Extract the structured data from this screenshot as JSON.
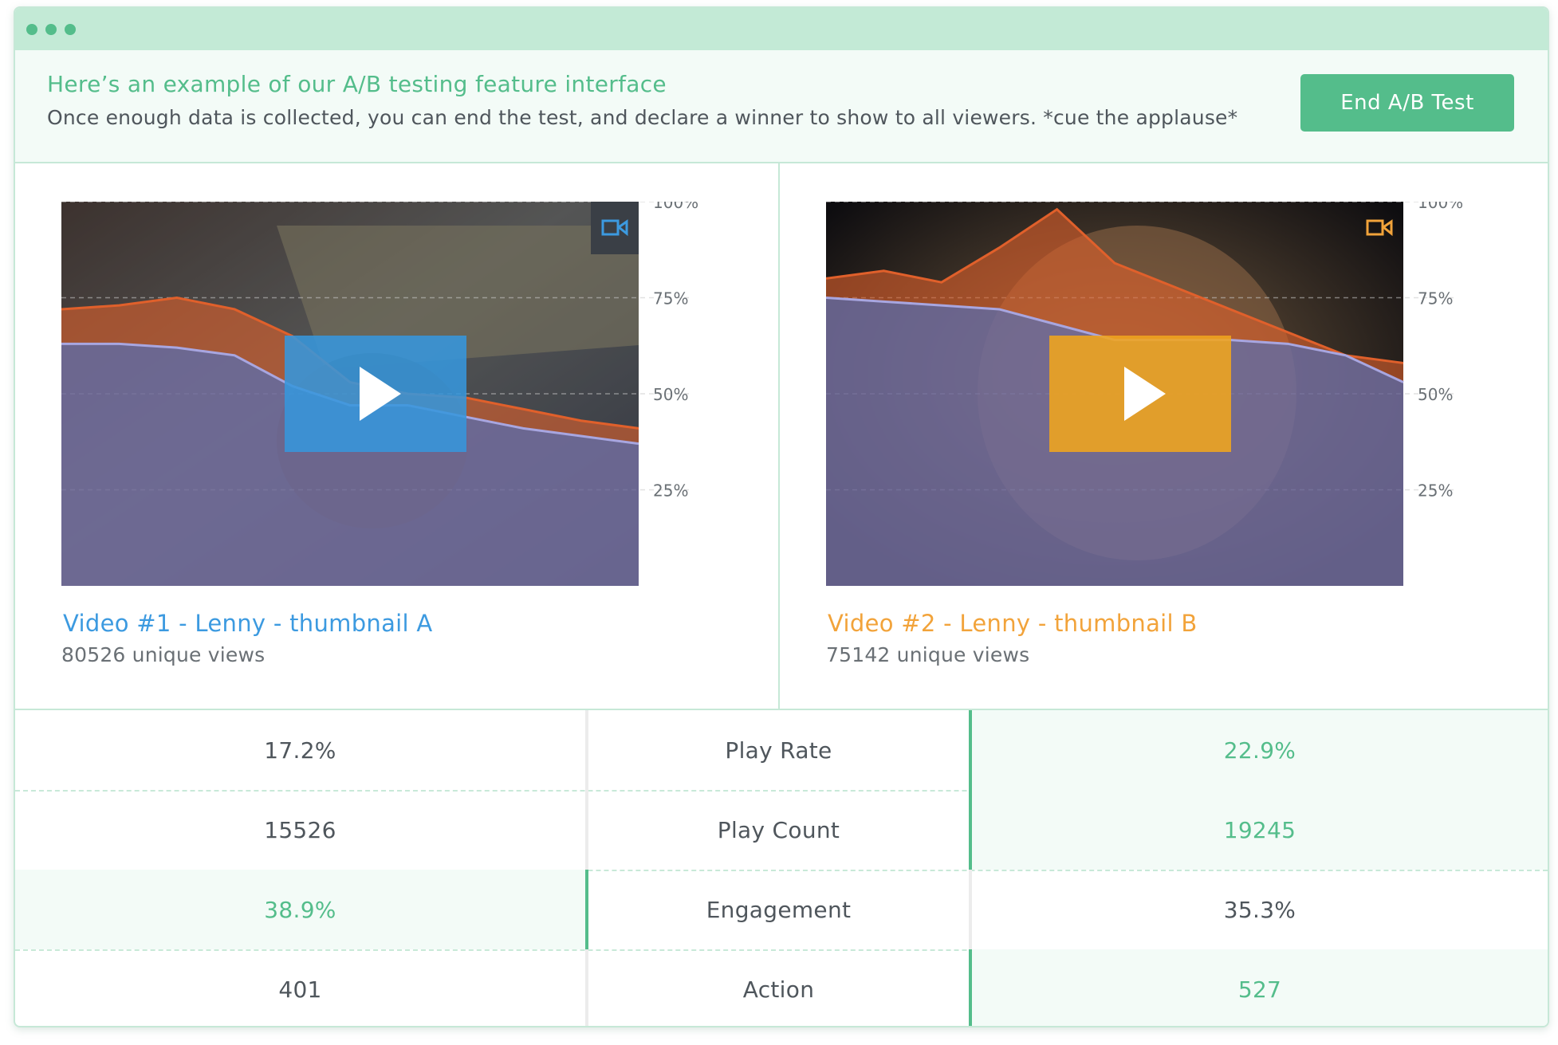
{
  "header": {
    "title": "Here’s an example of our A/B testing feature interface",
    "description": "Once enough data is collected, you can end the test, and declare a winner to show to all viewers. *cue the applause*",
    "end_button": "End A/B Test"
  },
  "videos": [
    {
      "title": "Video #1 - Lenny - thumbnail A",
      "views": "80526 unique views",
      "accent": "#3c9ae0",
      "icon": "video-camera-icon"
    },
    {
      "title": "Video #2 - Lenny - thumbnail B",
      "views": "75142 unique views",
      "accent": "#f2a33a",
      "icon": "video-camera-icon"
    }
  ],
  "chart_data": [
    {
      "type": "area",
      "ylim": [
        0,
        100
      ],
      "ytick_labels": [
        "100%",
        "75%",
        "50%",
        "25%"
      ],
      "x": [
        0,
        0.1,
        0.2,
        0.3,
        0.4,
        0.5,
        0.6,
        0.7,
        0.8,
        0.9,
        1.0
      ],
      "series": [
        {
          "values": [
            72,
            73,
            75,
            72,
            65,
            53,
            50,
            49,
            46,
            43,
            41
          ],
          "color": "#e0602b"
        },
        {
          "values": [
            63,
            63,
            62,
            60,
            52,
            47,
            47,
            44,
            41,
            39,
            37
          ],
          "color": "#4b72c8"
        }
      ]
    },
    {
      "type": "area",
      "ylim": [
        0,
        100
      ],
      "ytick_labels": [
        "100%",
        "75%",
        "50%",
        "25%"
      ],
      "x": [
        0,
        0.1,
        0.2,
        0.3,
        0.4,
        0.5,
        0.6,
        0.7,
        0.8,
        0.9,
        1.0
      ],
      "series": [
        {
          "values": [
            80,
            82,
            79,
            88,
            98,
            84,
            78,
            72,
            66,
            60,
            58
          ],
          "color": "#e0602b"
        },
        {
          "values": [
            75,
            74,
            73,
            72,
            68,
            64,
            64,
            64,
            63,
            60,
            53
          ],
          "color": "#4b72c8"
        }
      ]
    }
  ],
  "metrics": [
    {
      "label": "Play Rate",
      "a": "17.2%",
      "b": "22.9%",
      "winner": "b"
    },
    {
      "label": "Play Count",
      "a": "15526",
      "b": "19245",
      "winner": "b"
    },
    {
      "label": "Engagement",
      "a": "38.9%",
      "b": "35.3%",
      "winner": "a"
    },
    {
      "label": "Action",
      "a": "401",
      "b": "527",
      "winner": "b"
    }
  ]
}
